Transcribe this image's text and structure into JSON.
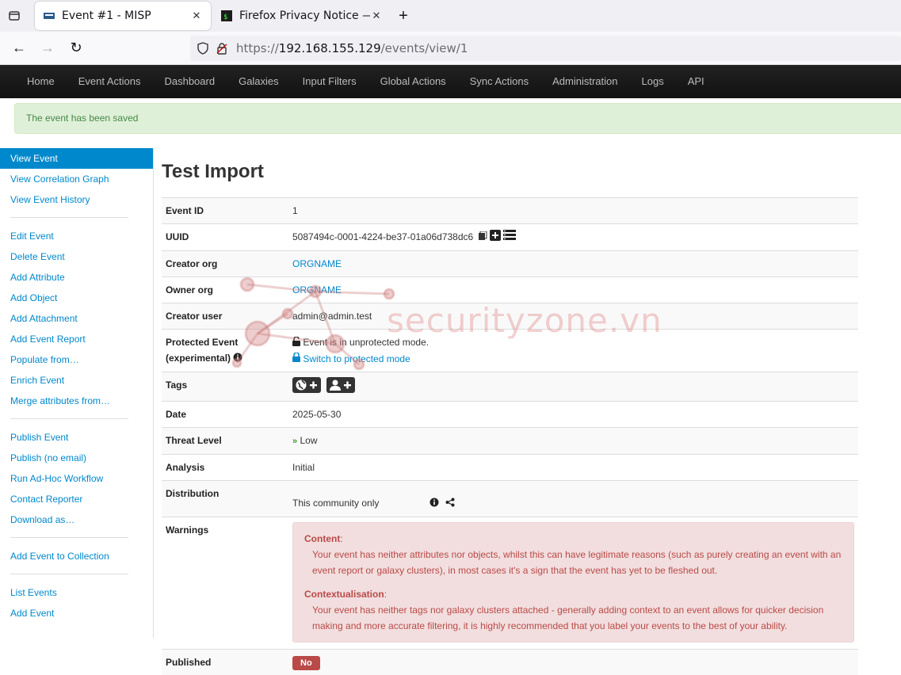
{
  "browser": {
    "tabs": [
      {
        "title": "Event #1 - MISP",
        "active": true
      },
      {
        "title": "Firefox Privacy Notice —",
        "active": false
      }
    ],
    "url": {
      "scheme": "https://",
      "host": "192.168.155.129",
      "path": "/events/view/1"
    }
  },
  "topmenu": [
    "Home",
    "Event Actions",
    "Dashboard",
    "Galaxies",
    "Input Filters",
    "Global Actions",
    "Sync Actions",
    "Administration",
    "Logs",
    "API"
  ],
  "alert": "The event has been saved",
  "sidebar": {
    "group1": [
      "View Event",
      "View Correlation Graph",
      "View Event History"
    ],
    "group2": [
      "Edit Event",
      "Delete Event",
      "Add Attribute",
      "Add Object",
      "Add Attachment",
      "Add Event Report",
      "Populate from…",
      "Enrich Event",
      "Merge attributes from…"
    ],
    "group3": [
      "Publish Event",
      "Publish (no email)",
      "Run Ad-Hoc Workflow",
      "Contact Reporter",
      "Download as…"
    ],
    "group4": [
      "Add Event to Collection"
    ],
    "group5": [
      "List Events",
      "Add Event"
    ]
  },
  "event": {
    "title": "Test Import",
    "labels": {
      "id": "Event ID",
      "uuid": "UUID",
      "creator_org": "Creator org",
      "owner_org": "Owner org",
      "creator_user": "Creator user",
      "protected_1": "Protected Event",
      "protected_2": "(experimental)",
      "tags": "Tags",
      "date": "Date",
      "threat": "Threat Level",
      "analysis": "Analysis",
      "distribution": "Distribution",
      "warnings": "Warnings",
      "published": "Published"
    },
    "id": "1",
    "uuid": "5087494c-0001-4224-be37-01a06d738dc6",
    "creator_org": "ORGNAME",
    "owner_org": "ORGNAME",
    "creator_user": "admin@admin.test",
    "protected_status": "Event is in unprotected mode.",
    "protected_switch": "Switch to protected mode",
    "date": "2025-05-30",
    "threat_level": "Low",
    "analysis": "Initial",
    "distribution": "This community only",
    "warnings": [
      {
        "title": "Content",
        "text": "Your event has neither attributes nor objects, whilst this can have legitimate reasons (such as purely creating an event with an event report or galaxy clusters), in most cases it's a sign that the event has yet to be fleshed out."
      },
      {
        "title": "Contextualisation",
        "text": "Your event has neither tags nor galaxy clusters attached - generally adding context to an event allows for quicker decision making and more accurate filtering, it is highly recommended that you label your events to the best of your ability."
      }
    ],
    "published": "No"
  },
  "watermark": "securityzone.vn",
  "colors": {
    "link": "#0088cc",
    "alert_bg": "#dff0d8",
    "warn_bg": "#f2dede",
    "danger": "#b94a48"
  }
}
